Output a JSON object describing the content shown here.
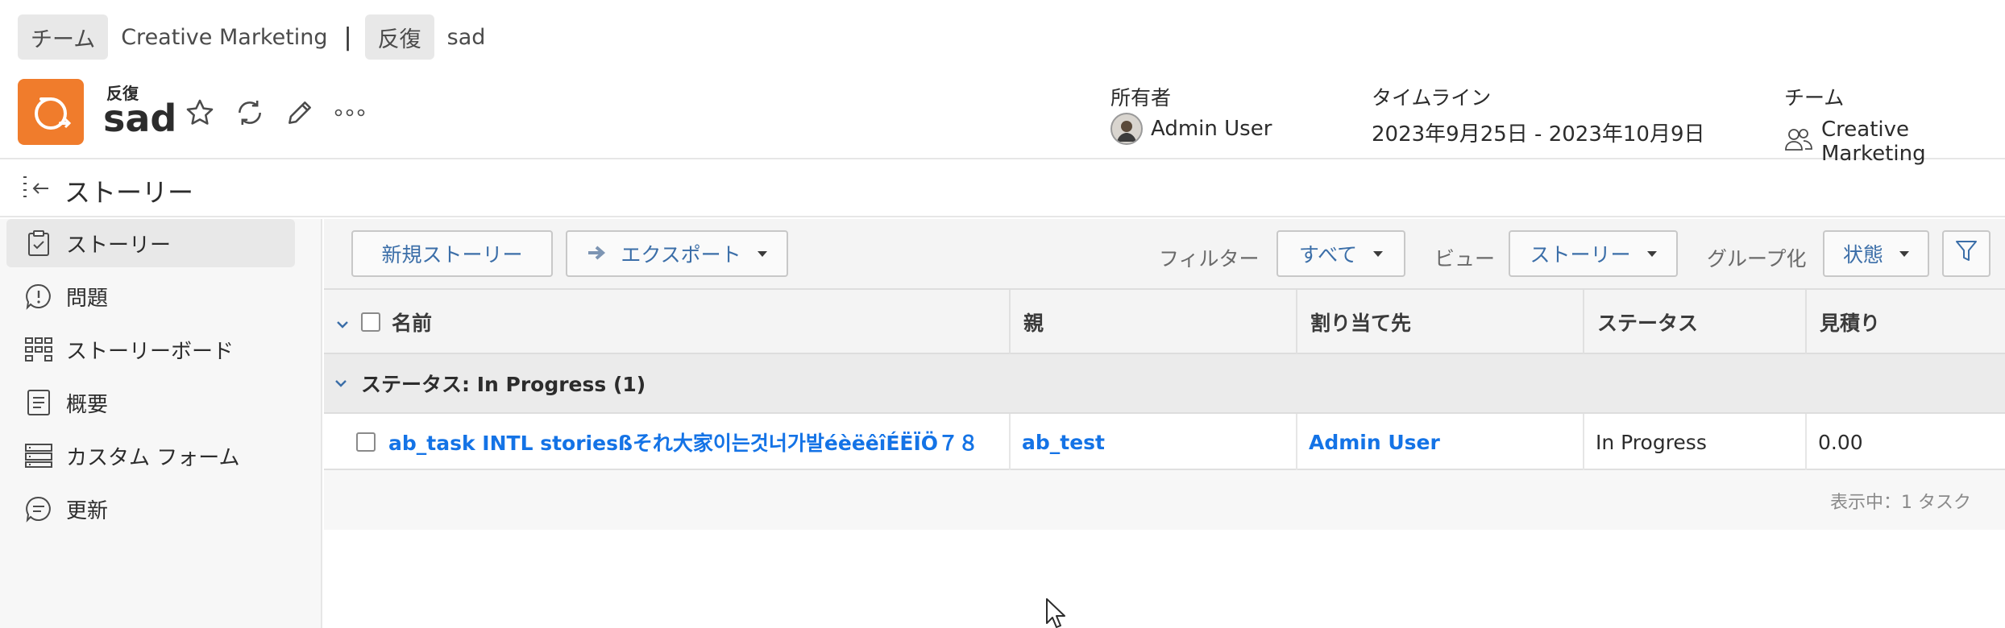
{
  "breadcrumb": {
    "team_label": "チーム",
    "team_name": "Creative Marketing",
    "separator": "|",
    "iteration_label": "反復",
    "iteration_name": "sad"
  },
  "header": {
    "object_type": "反復",
    "object_name": "sad",
    "icons": [
      "star-icon",
      "refresh-icon",
      "pencil-icon",
      "more-icon"
    ],
    "owner_label": "所有者",
    "owner_name": "Admin User",
    "timeline_label": "タイムライン",
    "timeline_value": "2023年9月25日 - 2023年10月9日",
    "team_label": "チーム",
    "team_value": "Creative Marketing"
  },
  "section": {
    "title": "ストーリー"
  },
  "sidebar": {
    "items": [
      {
        "label": "ストーリー",
        "icon": "clipboard-check-icon",
        "active": true
      },
      {
        "label": "問題",
        "icon": "issue-icon",
        "active": false
      },
      {
        "label": "ストーリーボード",
        "icon": "board-icon",
        "active": false
      },
      {
        "label": "概要",
        "icon": "document-icon",
        "active": false
      },
      {
        "label": "カスタム フォーム",
        "icon": "form-icon",
        "active": false
      },
      {
        "label": "更新",
        "icon": "chat-icon",
        "active": false
      }
    ]
  },
  "toolbar": {
    "new_story": "新規ストーリー",
    "export": "エクスポート",
    "filter_label": "フィルター",
    "filter_value": "すべて",
    "view_label": "ビュー",
    "view_value": "ストーリー",
    "group_label": "グループ化",
    "group_value": "状態"
  },
  "table": {
    "columns": [
      "名前",
      "親",
      "割り当て先",
      "ステータス",
      "見積り"
    ],
    "group": "ステータス: In Progress (1)",
    "rows": [
      {
        "name": "ab_task INTL storiesßそれ大家이는것너가발éèëêîÉËÏÖ７８",
        "parent": "ab_test",
        "assignee": "Admin User",
        "status": "In Progress",
        "estimate": "0.00"
      }
    ],
    "footer": "表示中：1 タスク"
  },
  "colors": {
    "accent_orange": "#f07c2c",
    "link_blue": "#1473e6",
    "button_text": "#3b6ea8"
  }
}
